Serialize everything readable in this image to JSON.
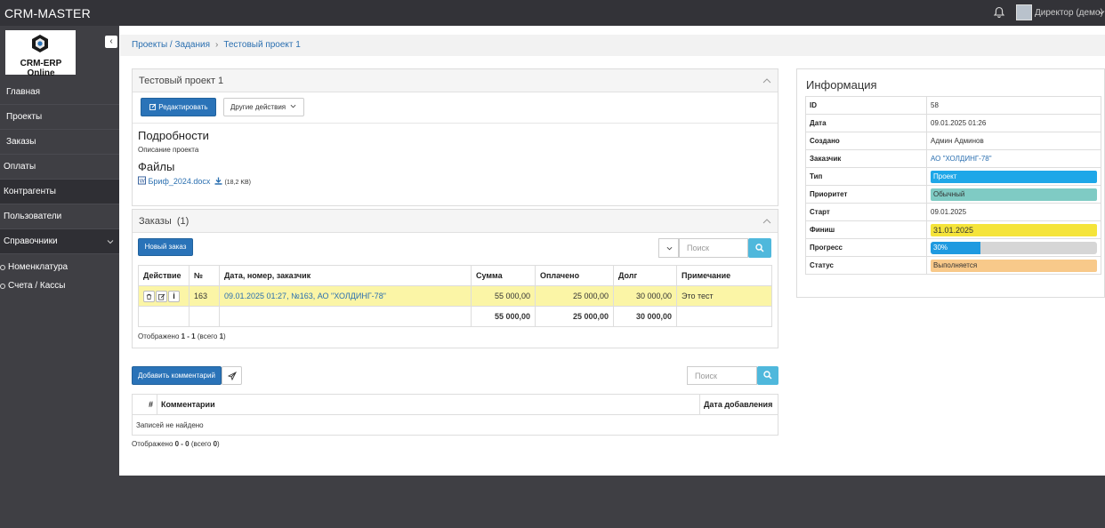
{
  "app": {
    "title": "CRM-MASTER",
    "user": "Директор (демо)",
    "logo_text": "CRM-ERP Online"
  },
  "sidebar": {
    "items": [
      {
        "label": "Главная"
      },
      {
        "label": "Проекты"
      },
      {
        "label": "Заказы"
      },
      {
        "label": "Оплаты"
      },
      {
        "label": "Контрагенты"
      },
      {
        "label": "Пользователи"
      },
      {
        "label": "Справочники"
      }
    ],
    "subitems": [
      {
        "label": "Номенклатура"
      },
      {
        "label": "Счета / Кассы"
      }
    ]
  },
  "breadcrumb": {
    "parent": "Проекты / Задания",
    "sep": "›",
    "current": "Тестовый проект 1"
  },
  "project": {
    "title": "Тестовый проект 1",
    "edit_label": "Редактировать",
    "other_actions_label": "Другие действия",
    "details_heading": "Подробности",
    "description": "Описание проекта",
    "files_heading": "Файлы",
    "file_name": "Бриф_2024.docx",
    "file_size": "(18,2 KB)"
  },
  "orders": {
    "title": "Заказы",
    "count": "(1)",
    "new_order_label": "Новый заказ",
    "search_placeholder": "Поиск",
    "columns": [
      "Действие",
      "№",
      "Дата, номер, заказчик",
      "Сумма",
      "Оплачено",
      "Долг",
      "Примечание"
    ],
    "rows": [
      {
        "num": "163",
        "desc": "09.01.2025 01:27, №163, АО \"ХОЛДИНГ-78\"",
        "sum": "55 000,00",
        "paid": "25 000,00",
        "debt": "30 000,00",
        "note": "Это тест"
      }
    ],
    "totals": {
      "sum": "55 000,00",
      "paid": "25 000,00",
      "debt": "30 000,00"
    },
    "shown_prefix": "Отображено ",
    "shown_range": "1 - 1",
    "shown_mid": " (всего ",
    "shown_total": "1",
    "shown_suffix": ")"
  },
  "info": {
    "title": "Информация",
    "id_label": "ID",
    "id_value": "58",
    "date_label": "Дата",
    "date_value": "09.01.2025 01:26",
    "created_label": "Создано",
    "created_value": "Админ Админов",
    "customer_label": "Заказчик",
    "customer_value": "АО \"ХОЛДИНГ-78\"",
    "type_label": "Тип",
    "type_value": "Проект",
    "priority_label": "Приоритет",
    "priority_value": "Обычный",
    "start_label": "Старт",
    "start_value": "09.01.2025",
    "finish_label": "Финиш",
    "finish_value": "31.01.2025",
    "progress_label": "Прогресс",
    "progress_value": "30%",
    "progress_fraction": 0.3,
    "status_label": "Статус",
    "status_value": "Выполняется"
  },
  "comments": {
    "add_label": "Добавить комментарий",
    "search_placeholder": "Поиск",
    "columns": [
      "#",
      "Комментарии",
      "Дата добавления"
    ],
    "empty": "Записей не найдено",
    "shown_prefix": "Отображено ",
    "shown_range": "0 - 0",
    "shown_mid": " (всего ",
    "shown_total": "0",
    "shown_suffix": ")"
  },
  "colors": {
    "accent": "#2a73b8",
    "highlight_row": "#fbf5a6",
    "type_pill": "#1ea7e8",
    "priority_pill": "#7fcbc4",
    "finish_pill": "#f5e43a",
    "status_pill": "#f8c98a",
    "search_button": "#4fb8dc"
  }
}
